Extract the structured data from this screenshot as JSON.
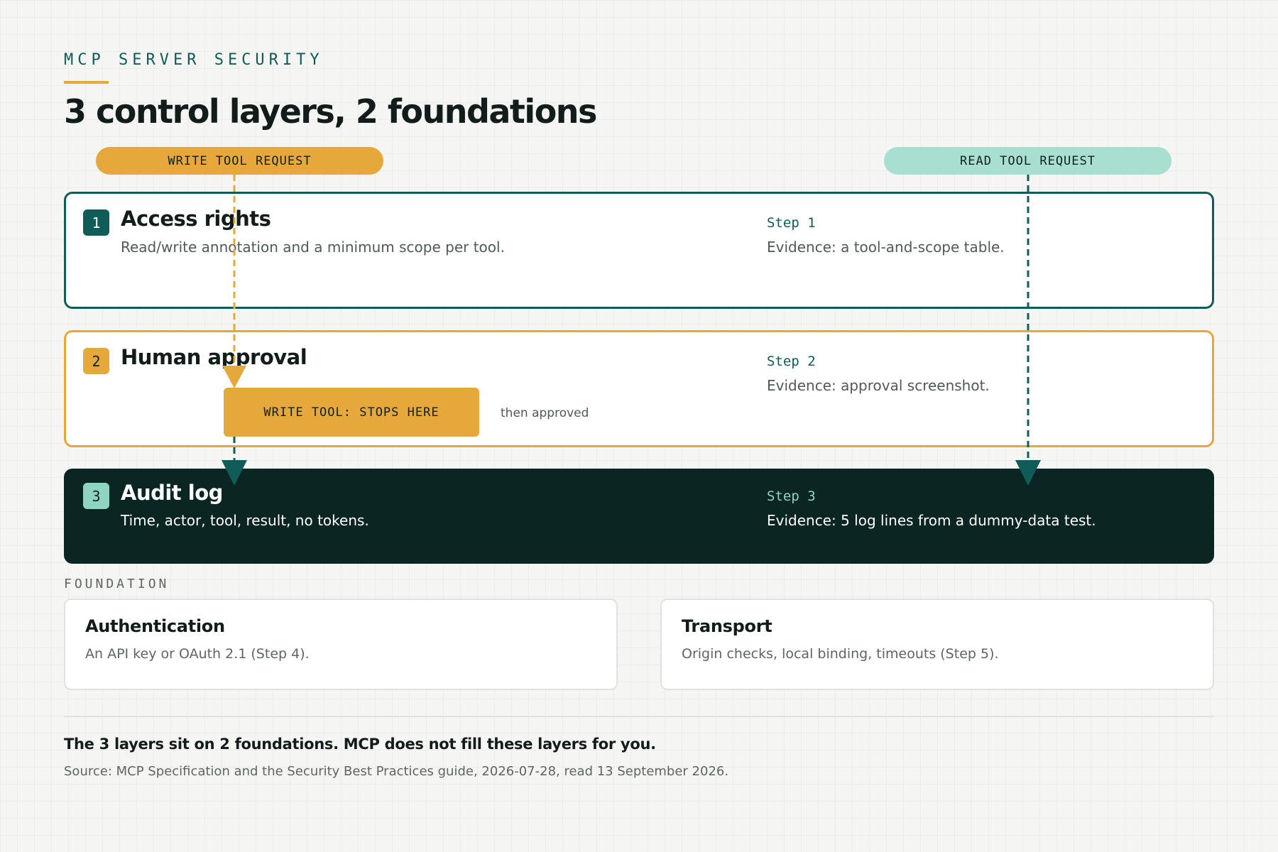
{
  "header": {
    "eyebrow": "MCP SERVER SECURITY",
    "title": "3 control layers, 2 foundations"
  },
  "requests": {
    "write": "WRITE TOOL REQUEST",
    "read": "READ TOOL REQUEST"
  },
  "layers": [
    {
      "number": "1",
      "title": "Access rights",
      "description": "Read/write annotation and a minimum scope per tool.",
      "step": "Step 1",
      "evidence": "Evidence: a tool-and-scope table."
    },
    {
      "number": "2",
      "title": "Human approval",
      "step": "Step 2",
      "evidence": "Evidence: approval screenshot.",
      "stop_label": "WRITE TOOL: STOPS HERE",
      "after_stop": "then approved"
    },
    {
      "number": "3",
      "title": "Audit log",
      "description": "Time, actor, tool, result, no tokens.",
      "step": "Step 3",
      "evidence": "Evidence: 5 log lines from a dummy-data test."
    }
  ],
  "foundation": {
    "label": "FOUNDATION",
    "cards": [
      {
        "title": "Authentication",
        "description": "An API key or OAuth 2.1 (Step 4)."
      },
      {
        "title": "Transport",
        "description": "Origin checks, local binding, timeouts (Step 5)."
      }
    ]
  },
  "footer": {
    "note": "The 3 layers sit on 2 foundations. MCP does not fill these layers for you.",
    "source": "Source: MCP Specification and the Security Best Practices guide, 2026-07-28, read 13 September 2026."
  },
  "colors": {
    "teal": "#0f5c58",
    "amber": "#e7a83b",
    "mint": "#a8dfd1",
    "dark": "#0b2622"
  }
}
